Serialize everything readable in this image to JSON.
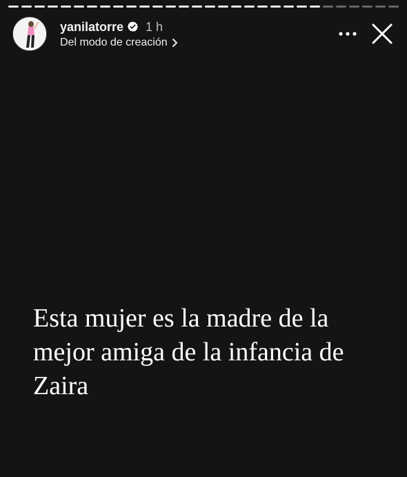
{
  "story": {
    "progress": {
      "segments_total": 30,
      "segments_viewed": 24
    },
    "author": {
      "username": "yanilatorre",
      "verified": true,
      "time_ago": "1 h",
      "source_label": "Del modo de creación"
    },
    "caption": "Esta mujer es la madre de la mejor amiga de la infancia de Zaira",
    "colors": {
      "background": "#141414",
      "text": "#ffffff",
      "verified_badge": "#ffffff"
    },
    "icons": {
      "more": "more-horizontal-icon",
      "close": "close-icon",
      "verified": "verified-badge-icon",
      "chevron": "chevron-right-icon"
    }
  }
}
